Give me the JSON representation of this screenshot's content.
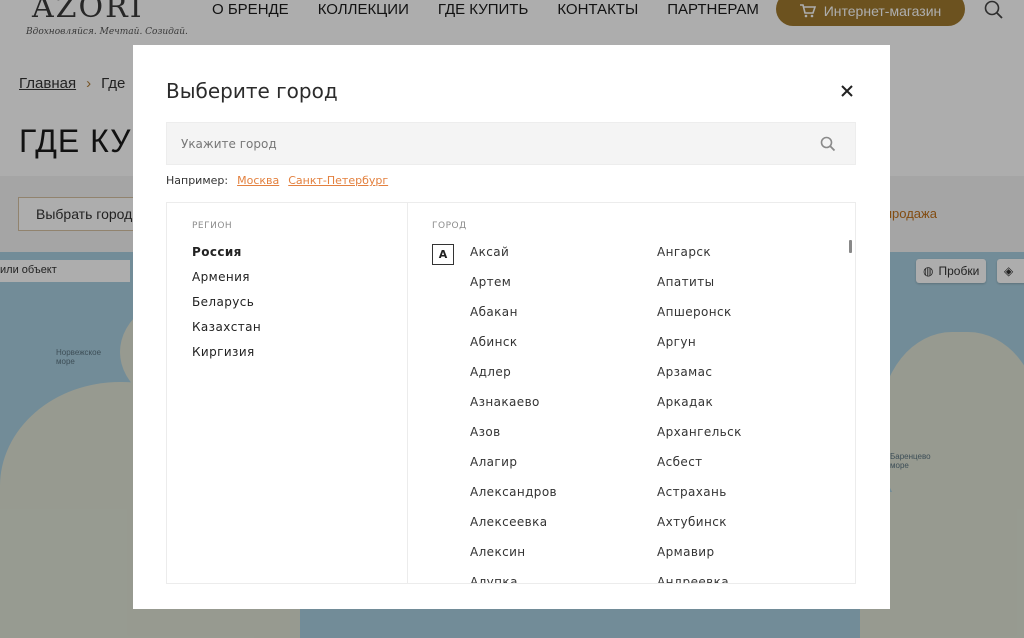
{
  "header": {
    "logo_text": "AZORI",
    "logo_slogan": "Вдохновляйся. Мечтай. Созидай.",
    "nav": [
      "О БРЕНДЕ",
      "КОЛЛЕКЦИИ",
      "ГДЕ КУПИТЬ",
      "КОНТАКТЫ",
      "ПАРТНЕРАМ"
    ],
    "shop_button": "Интернет-магазин",
    "accent_color": "#a07a2e"
  },
  "breadcrumb": {
    "home": "Главная",
    "current": "Где"
  },
  "page_title": "ГДЕ КУ",
  "filters": {
    "city_button": "Выбрать город",
    "sale_link": "продажа"
  },
  "map": {
    "search_text": "или объект",
    "probes_button": "Пробки",
    "labels": [
      "Норвежское море",
      "Баренцево море"
    ]
  },
  "modal": {
    "title": "Выберите город",
    "search_placeholder": "Укажите город",
    "examples_label": "Например:",
    "examples": [
      "Москва",
      "Санкт-Петербург"
    ],
    "region_header": "РЕГИОН",
    "city_header": "ГОРОД",
    "regions": [
      {
        "name": "Россия",
        "active": true
      },
      {
        "name": "Армения",
        "active": false
      },
      {
        "name": "Беларусь",
        "active": false
      },
      {
        "name": "Казахстан",
        "active": false
      },
      {
        "name": "Киргизия",
        "active": false
      }
    ],
    "letter": "А",
    "cities_col1": [
      "Аксай",
      "Артем",
      "Абакан",
      "Абинск",
      "Адлер",
      "Азнакаево",
      "Азов",
      "Алагир",
      "Александров",
      "Алексеевка",
      "Алексин",
      "Алупка"
    ],
    "cities_col2": [
      "Ангарск",
      "Апатиты",
      "Апшеронск",
      "Аргун",
      "Арзамас",
      "Аркадак",
      "Архангельск",
      "Асбест",
      "Астрахань",
      "Ахтубинск",
      "Армавир",
      "Андреевка"
    ],
    "link_color": "#e3803e"
  }
}
